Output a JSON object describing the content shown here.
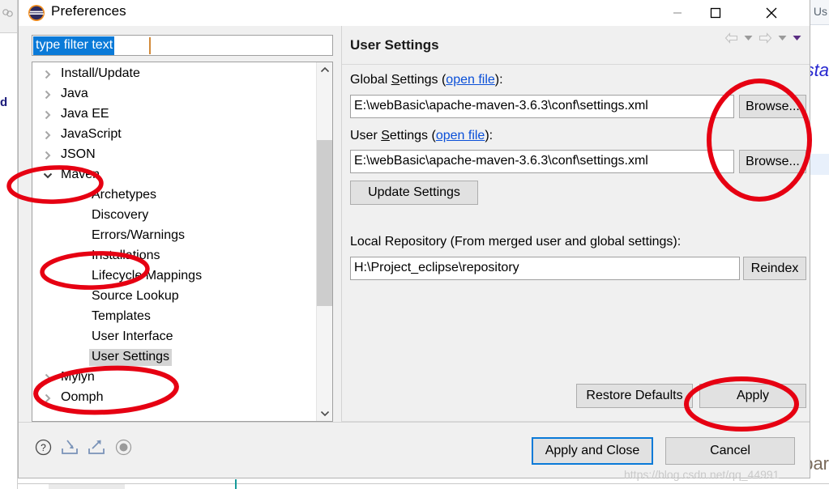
{
  "window": {
    "title": "Preferences",
    "icon": "eclipse-icon",
    "controls": {
      "minimize": "minimize-icon",
      "maximize": "maximize-icon",
      "close": "close-icon"
    }
  },
  "filter": {
    "value": "type filter text",
    "placeholder": "type filter text",
    "selected": true
  },
  "tree": {
    "items": [
      {
        "label": "Install/Update",
        "indent": 0,
        "state": "collapsed",
        "selected": false
      },
      {
        "label": "Java",
        "indent": 0,
        "state": "collapsed",
        "selected": false
      },
      {
        "label": "Java EE",
        "indent": 0,
        "state": "collapsed",
        "selected": false
      },
      {
        "label": "JavaScript",
        "indent": 0,
        "state": "collapsed",
        "selected": false
      },
      {
        "label": "JSON",
        "indent": 0,
        "state": "collapsed",
        "selected": false
      },
      {
        "label": "Maven",
        "indent": 0,
        "state": "expanded",
        "selected": false
      },
      {
        "label": "Archetypes",
        "indent": 1,
        "state": "leaf",
        "selected": false
      },
      {
        "label": "Discovery",
        "indent": 1,
        "state": "leaf",
        "selected": false
      },
      {
        "label": "Errors/Warnings",
        "indent": 1,
        "state": "leaf",
        "selected": false
      },
      {
        "label": "Installations",
        "indent": 1,
        "state": "leaf",
        "selected": false
      },
      {
        "label": "Lifecycle Mappings",
        "indent": 1,
        "state": "leaf",
        "selected": false
      },
      {
        "label": "Source Lookup",
        "indent": 1,
        "state": "leaf",
        "selected": false
      },
      {
        "label": "Templates",
        "indent": 1,
        "state": "leaf",
        "selected": false
      },
      {
        "label": "User Interface",
        "indent": 1,
        "state": "leaf",
        "selected": false
      },
      {
        "label": "User Settings",
        "indent": 1,
        "state": "leaf",
        "selected": true
      },
      {
        "label": "Mylyn",
        "indent": 0,
        "state": "collapsed",
        "selected": false
      },
      {
        "label": "Oomph",
        "indent": 0,
        "state": "collapsed",
        "selected": false
      }
    ],
    "scrollbar": {
      "up": "chevron-up-icon",
      "down": "chevron-down-icon"
    }
  },
  "page": {
    "title": "User Settings",
    "nav": {
      "back": "arrow-left-icon",
      "back_menu": "chevron-down-icon",
      "forward": "arrow-right-icon",
      "forward_menu": "chevron-down-icon",
      "view_menu": "chevron-down-icon"
    },
    "global_settings": {
      "label_prefix": "Global ",
      "label_mnemonic": "S",
      "label_suffix": "ettings (",
      "link": "open file",
      "label_end": "):",
      "value": "E:\\webBasic\\apache-maven-3.6.3\\conf\\settings.xml",
      "browse_label": "Browse..."
    },
    "user_settings": {
      "label_prefix": "User ",
      "label_mnemonic": "S",
      "label_suffix": "ettings (",
      "link": "open file",
      "label_end": "):",
      "value": "E:\\webBasic\\apache-maven-3.6.3\\conf\\settings.xml",
      "browse_label": "Browse..."
    },
    "update_settings_label": "Update Settings",
    "local_repository": {
      "label": "Local Repository (From merged user and global settings):",
      "value": "H:\\Project_eclipse\\repository",
      "reindex_label": "Reindex"
    },
    "restore_defaults_label": "Restore Defaults",
    "apply_label": "Apply"
  },
  "footer": {
    "icons": [
      {
        "name": "help-icon"
      },
      {
        "name": "import-icon"
      },
      {
        "name": "export-icon"
      },
      {
        "name": "oomph-record-icon"
      }
    ],
    "apply_and_close_label": "Apply and Close",
    "cancel_label": "Cancel"
  },
  "background": {
    "tab_label": "Us",
    "code_text": "sta",
    "bottom_text": "par",
    "left_text": "d"
  },
  "watermark": "https://blog.csdn.net/qq_44991",
  "annotations": {
    "color": "#e60012",
    "ellipses": [
      {
        "name": "annotation-maven",
        "target": "Maven"
      },
      {
        "name": "annotation-installations",
        "target": "Installations"
      },
      {
        "name": "annotation-user-settings",
        "target": "User Settings"
      },
      {
        "name": "annotation-browse-buttons",
        "target": "Browse..."
      },
      {
        "name": "annotation-apply",
        "target": "Apply"
      }
    ]
  },
  "colors": {
    "accent": "#0a7ad8",
    "annotation_red": "#e60012",
    "link": "#0a4fd8",
    "dialog_bg": "#f0f0f0",
    "selection_bg": "#d4d4d4"
  }
}
